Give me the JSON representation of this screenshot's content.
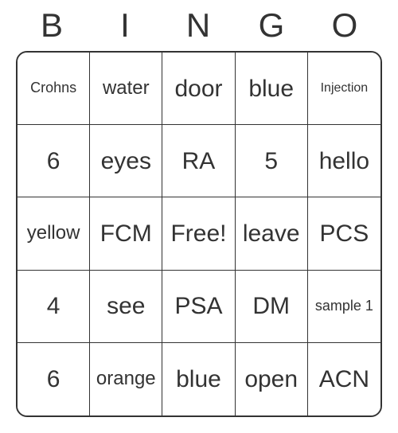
{
  "header": [
    "B",
    "I",
    "N",
    "G",
    "O"
  ],
  "grid": [
    [
      {
        "text": "Crohns",
        "size": "fs-small"
      },
      {
        "text": "water",
        "size": "fs-med"
      },
      {
        "text": "door",
        "size": "fs-large"
      },
      {
        "text": "blue",
        "size": "fs-large"
      },
      {
        "text": "Injection",
        "size": "fs-xs"
      }
    ],
    [
      {
        "text": "6",
        "size": "fs-large"
      },
      {
        "text": "eyes",
        "size": "fs-large"
      },
      {
        "text": "RA",
        "size": "fs-large"
      },
      {
        "text": "5",
        "size": "fs-large"
      },
      {
        "text": "hello",
        "size": "fs-large"
      }
    ],
    [
      {
        "text": "yellow",
        "size": "fs-med"
      },
      {
        "text": "FCM",
        "size": "fs-large"
      },
      {
        "text": "Free!",
        "size": "fs-large"
      },
      {
        "text": "leave",
        "size": "fs-large"
      },
      {
        "text": "PCS",
        "size": "fs-large"
      }
    ],
    [
      {
        "text": "4",
        "size": "fs-large"
      },
      {
        "text": "see",
        "size": "fs-large"
      },
      {
        "text": "PSA",
        "size": "fs-large"
      },
      {
        "text": "DM",
        "size": "fs-large"
      },
      {
        "text": "sample 1",
        "size": "fs-small"
      }
    ],
    [
      {
        "text": "6",
        "size": "fs-large"
      },
      {
        "text": "orange",
        "size": "fs-med"
      },
      {
        "text": "blue",
        "size": "fs-large"
      },
      {
        "text": "open",
        "size": "fs-large"
      },
      {
        "text": "ACN",
        "size": "fs-large"
      }
    ]
  ]
}
